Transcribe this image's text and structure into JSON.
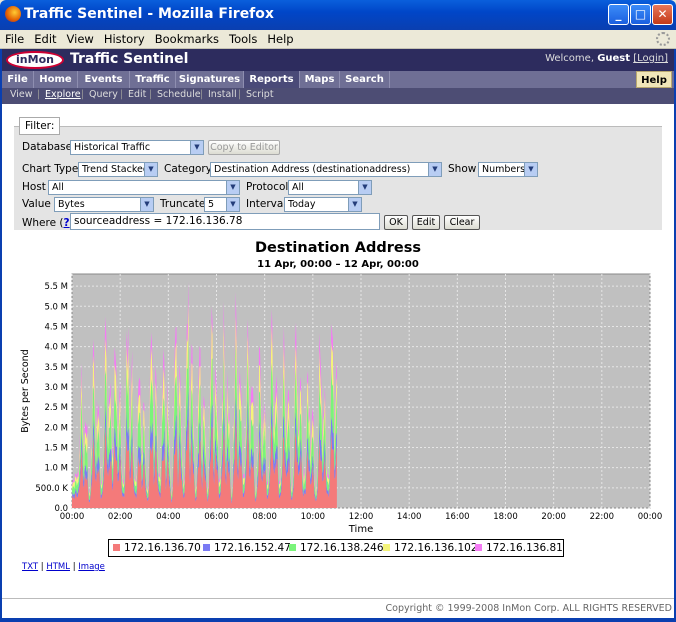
{
  "window": {
    "title": "Traffic Sentinel - Mozilla Firefox"
  },
  "menubar": {
    "items": [
      "File",
      "Edit",
      "View",
      "History",
      "Bookmarks",
      "Tools",
      "Help"
    ]
  },
  "app": {
    "logo": "inMon",
    "name": "Traffic Sentinel",
    "welcome_prefix": "Welcome,",
    "user": "Guest",
    "login": "[Login]"
  },
  "tabs": [
    "File",
    "Home",
    "Events",
    "Traffic",
    "Signatures",
    "Reports",
    "Maps",
    "Search"
  ],
  "help_tab": "Help",
  "subtabs": [
    "View",
    "Explore",
    "Query",
    "Edit",
    "Schedule",
    "Install",
    "Script"
  ],
  "filter": {
    "legend": "Filter:",
    "database_label": "Database",
    "database_value": "Historical Traffic",
    "copy_to_editor": "Copy to Editor",
    "chart_type_label": "Chart Type",
    "chart_type_value": "Trend Stacked",
    "category_label": "Category",
    "category_value": "Destination Address (destinationaddress)",
    "show_label": "Show",
    "show_value": "Numbers",
    "host_label": "Host",
    "host_value": "All",
    "protocol_label": "Protocol",
    "protocol_value": "All",
    "value_label": "Value",
    "value_value": "Bytes",
    "truncate_label": "Truncate",
    "truncate_value": "5",
    "interval_label": "Interval",
    "interval_value": "Today",
    "where_label": "Where",
    "where_help": "?",
    "where_value": "sourceaddress = 172.16.136.78",
    "ok": "OK",
    "edit": "Edit",
    "clear": "Clear"
  },
  "chart_data": {
    "type": "area",
    "title": "Destination Address",
    "subtitle": "11 Apr, 00:00 –  12 Apr, 00:00",
    "xlabel": "Time",
    "ylabel": "Bytes per Second",
    "x_ticks": [
      "00:00",
      "02:00",
      "04:00",
      "06:00",
      "08:00",
      "10:00",
      "12:00",
      "14:00",
      "16:00",
      "18:00",
      "20:00",
      "22:00",
      "00:00"
    ],
    "y_ticks": [
      "0.0",
      "500.0 K",
      "1.0 M",
      "1.5 M",
      "2.0 M",
      "2.5 M",
      "3.0 M",
      "3.5 M",
      "4.0 M",
      "4.5 M",
      "5.0 M",
      "5.5 M"
    ],
    "ylim": [
      0,
      5800000
    ],
    "xlim_hours": [
      0,
      24
    ],
    "grid": true,
    "legend_position": "bottom",
    "series": [
      {
        "name": "172.16.136.70",
        "color": "#f47a7a"
      },
      {
        "name": "172.16.152.47",
        "color": "#7a7af4"
      },
      {
        "name": "172.16.138.246",
        "color": "#7af47a"
      },
      {
        "name": "172.16.136.102",
        "color": "#f4f47a"
      },
      {
        "name": "172.16.136.81",
        "color": "#f47af4"
      }
    ],
    "peaks": [
      {
        "hour": 0.4,
        "value": 3200000
      },
      {
        "hour": 0.9,
        "value": 3900000
      },
      {
        "hour": 1.4,
        "value": 4500000
      },
      {
        "hour": 1.8,
        "value": 4100000
      },
      {
        "hour": 2.3,
        "value": 4700000
      },
      {
        "hour": 2.8,
        "value": 3500000
      },
      {
        "hour": 3.3,
        "value": 4600000
      },
      {
        "hour": 3.8,
        "value": 3900000
      },
      {
        "hour": 4.3,
        "value": 4700000
      },
      {
        "hour": 4.8,
        "value": 5400000
      },
      {
        "hour": 5.3,
        "value": 4000000
      },
      {
        "hour": 5.8,
        "value": 4800000
      },
      {
        "hour": 6.3,
        "value": 4300000
      },
      {
        "hour": 6.8,
        "value": 4900000
      },
      {
        "hour": 7.3,
        "value": 4500000
      },
      {
        "hour": 7.8,
        "value": 3800000
      },
      {
        "hour": 8.3,
        "value": 4700000
      },
      {
        "hour": 8.8,
        "value": 4200000
      },
      {
        "hour": 9.3,
        "value": 4500000
      },
      {
        "hour": 9.8,
        "value": 3400000
      },
      {
        "hour": 10.3,
        "value": 4100000
      },
      {
        "hour": 10.8,
        "value": 4800000
      }
    ],
    "data_end_hour": 11.0
  },
  "export_links": [
    "TXT",
    "HTML",
    "Image"
  ],
  "footer": "Copyright © 1999-2008 InMon Corp. ALL RIGHTS RESERVED"
}
